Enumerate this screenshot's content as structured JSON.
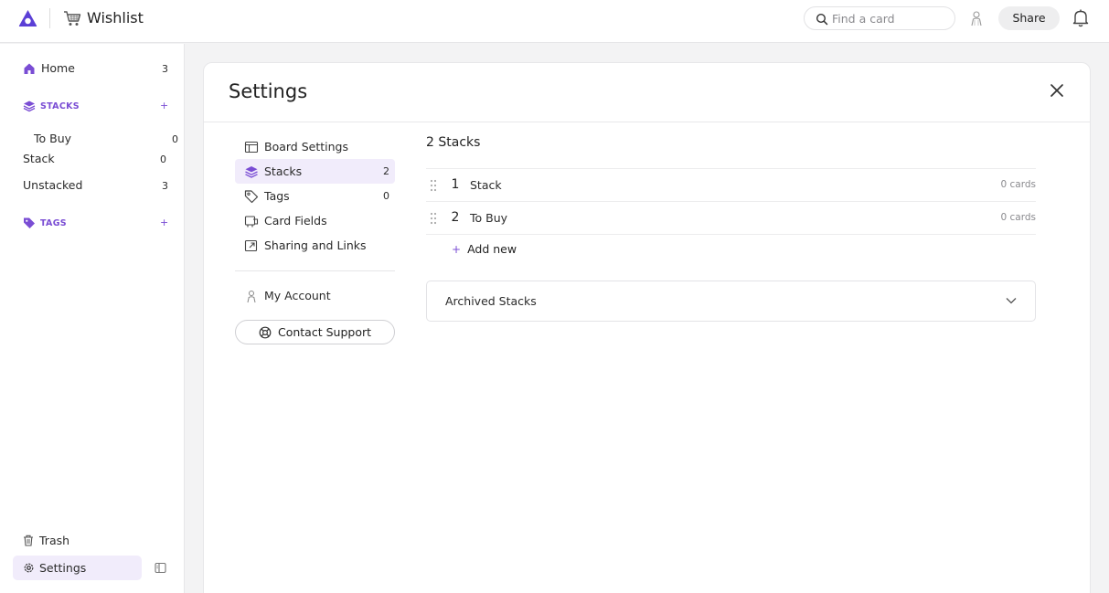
{
  "colors": {
    "accent": "#7a4dd4",
    "logo": "#5b3fd6",
    "active_bg": "#f1ecfb"
  },
  "header": {
    "board_title": "Wishlist",
    "search_placeholder": "Find a card",
    "share_label": "Share"
  },
  "sidebar": {
    "home": {
      "label": "Home",
      "count": "3"
    },
    "stacks_section": "STACKS",
    "stacks": [
      {
        "label": "To Buy",
        "count": "0"
      },
      {
        "label": "Stack",
        "count": "0"
      },
      {
        "label": "Unstacked",
        "count": "3"
      }
    ],
    "tags_section": "TAGS",
    "trash_label": "Trash",
    "settings_label": "Settings"
  },
  "settings": {
    "title": "Settings",
    "nav": [
      {
        "label": "Board Settings",
        "count": "",
        "icon": "board-icon"
      },
      {
        "label": "Stacks",
        "count": "2",
        "icon": "layers-icon"
      },
      {
        "label": "Tags",
        "count": "0",
        "icon": "tag-icon"
      },
      {
        "label": "Card Fields",
        "count": "",
        "icon": "card-fields-icon"
      },
      {
        "label": "Sharing and Links",
        "count": "",
        "icon": "share-link-icon"
      }
    ],
    "my_account_label": "My Account",
    "contact_support_label": "Contact Support",
    "stacks_heading": "2 Stacks",
    "stack_rows": [
      {
        "num": "1",
        "name": "Stack",
        "cards": "0 cards"
      },
      {
        "num": "2",
        "name": "To Buy",
        "cards": "0 cards"
      }
    ],
    "add_new_label": "Add new",
    "archived_label": "Archived Stacks"
  }
}
